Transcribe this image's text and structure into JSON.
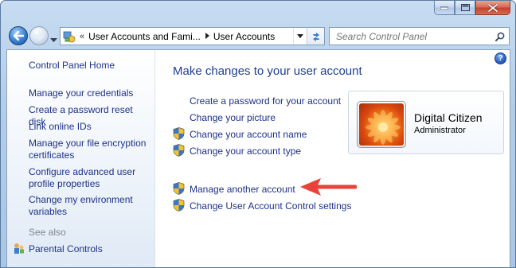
{
  "window": {
    "caption_buttons": [
      "minimize",
      "maximize",
      "close"
    ]
  },
  "nav": {
    "back_icon": "back-arrow-icon",
    "forward_icon": "forward-arrow-icon"
  },
  "address": {
    "overflow": "«",
    "crumbs": [
      "User Accounts and Fami...",
      "User Accounts"
    ]
  },
  "search": {
    "placeholder": "Search Control Panel"
  },
  "sidebar": {
    "home": "Control Panel Home",
    "links": [
      "Manage your credentials",
      "Create a password reset disk",
      "Link online IDs",
      "Manage your file encryption certificates",
      "Configure advanced user profile properties",
      "Change my environment variables"
    ],
    "see_also_heading": "See also",
    "see_also": [
      "Parental Controls"
    ]
  },
  "main": {
    "title": "Make changes to your user account",
    "tasks": [
      {
        "label": "Create a password for your account",
        "shield": false
      },
      {
        "label": "Change your picture",
        "shield": false
      },
      {
        "label": "Change your account name",
        "shield": true
      },
      {
        "label": "Change your account type",
        "shield": true
      }
    ],
    "other_tasks": [
      {
        "label": "Manage another account",
        "shield": true
      },
      {
        "label": "Change User Account Control settings",
        "shield": true
      }
    ]
  },
  "account": {
    "name": "Digital Citizen",
    "role": "Administrator"
  },
  "colors": {
    "link": "#1e3287",
    "title": "#1e3e8f",
    "annotation_arrow": "#e8423a"
  }
}
